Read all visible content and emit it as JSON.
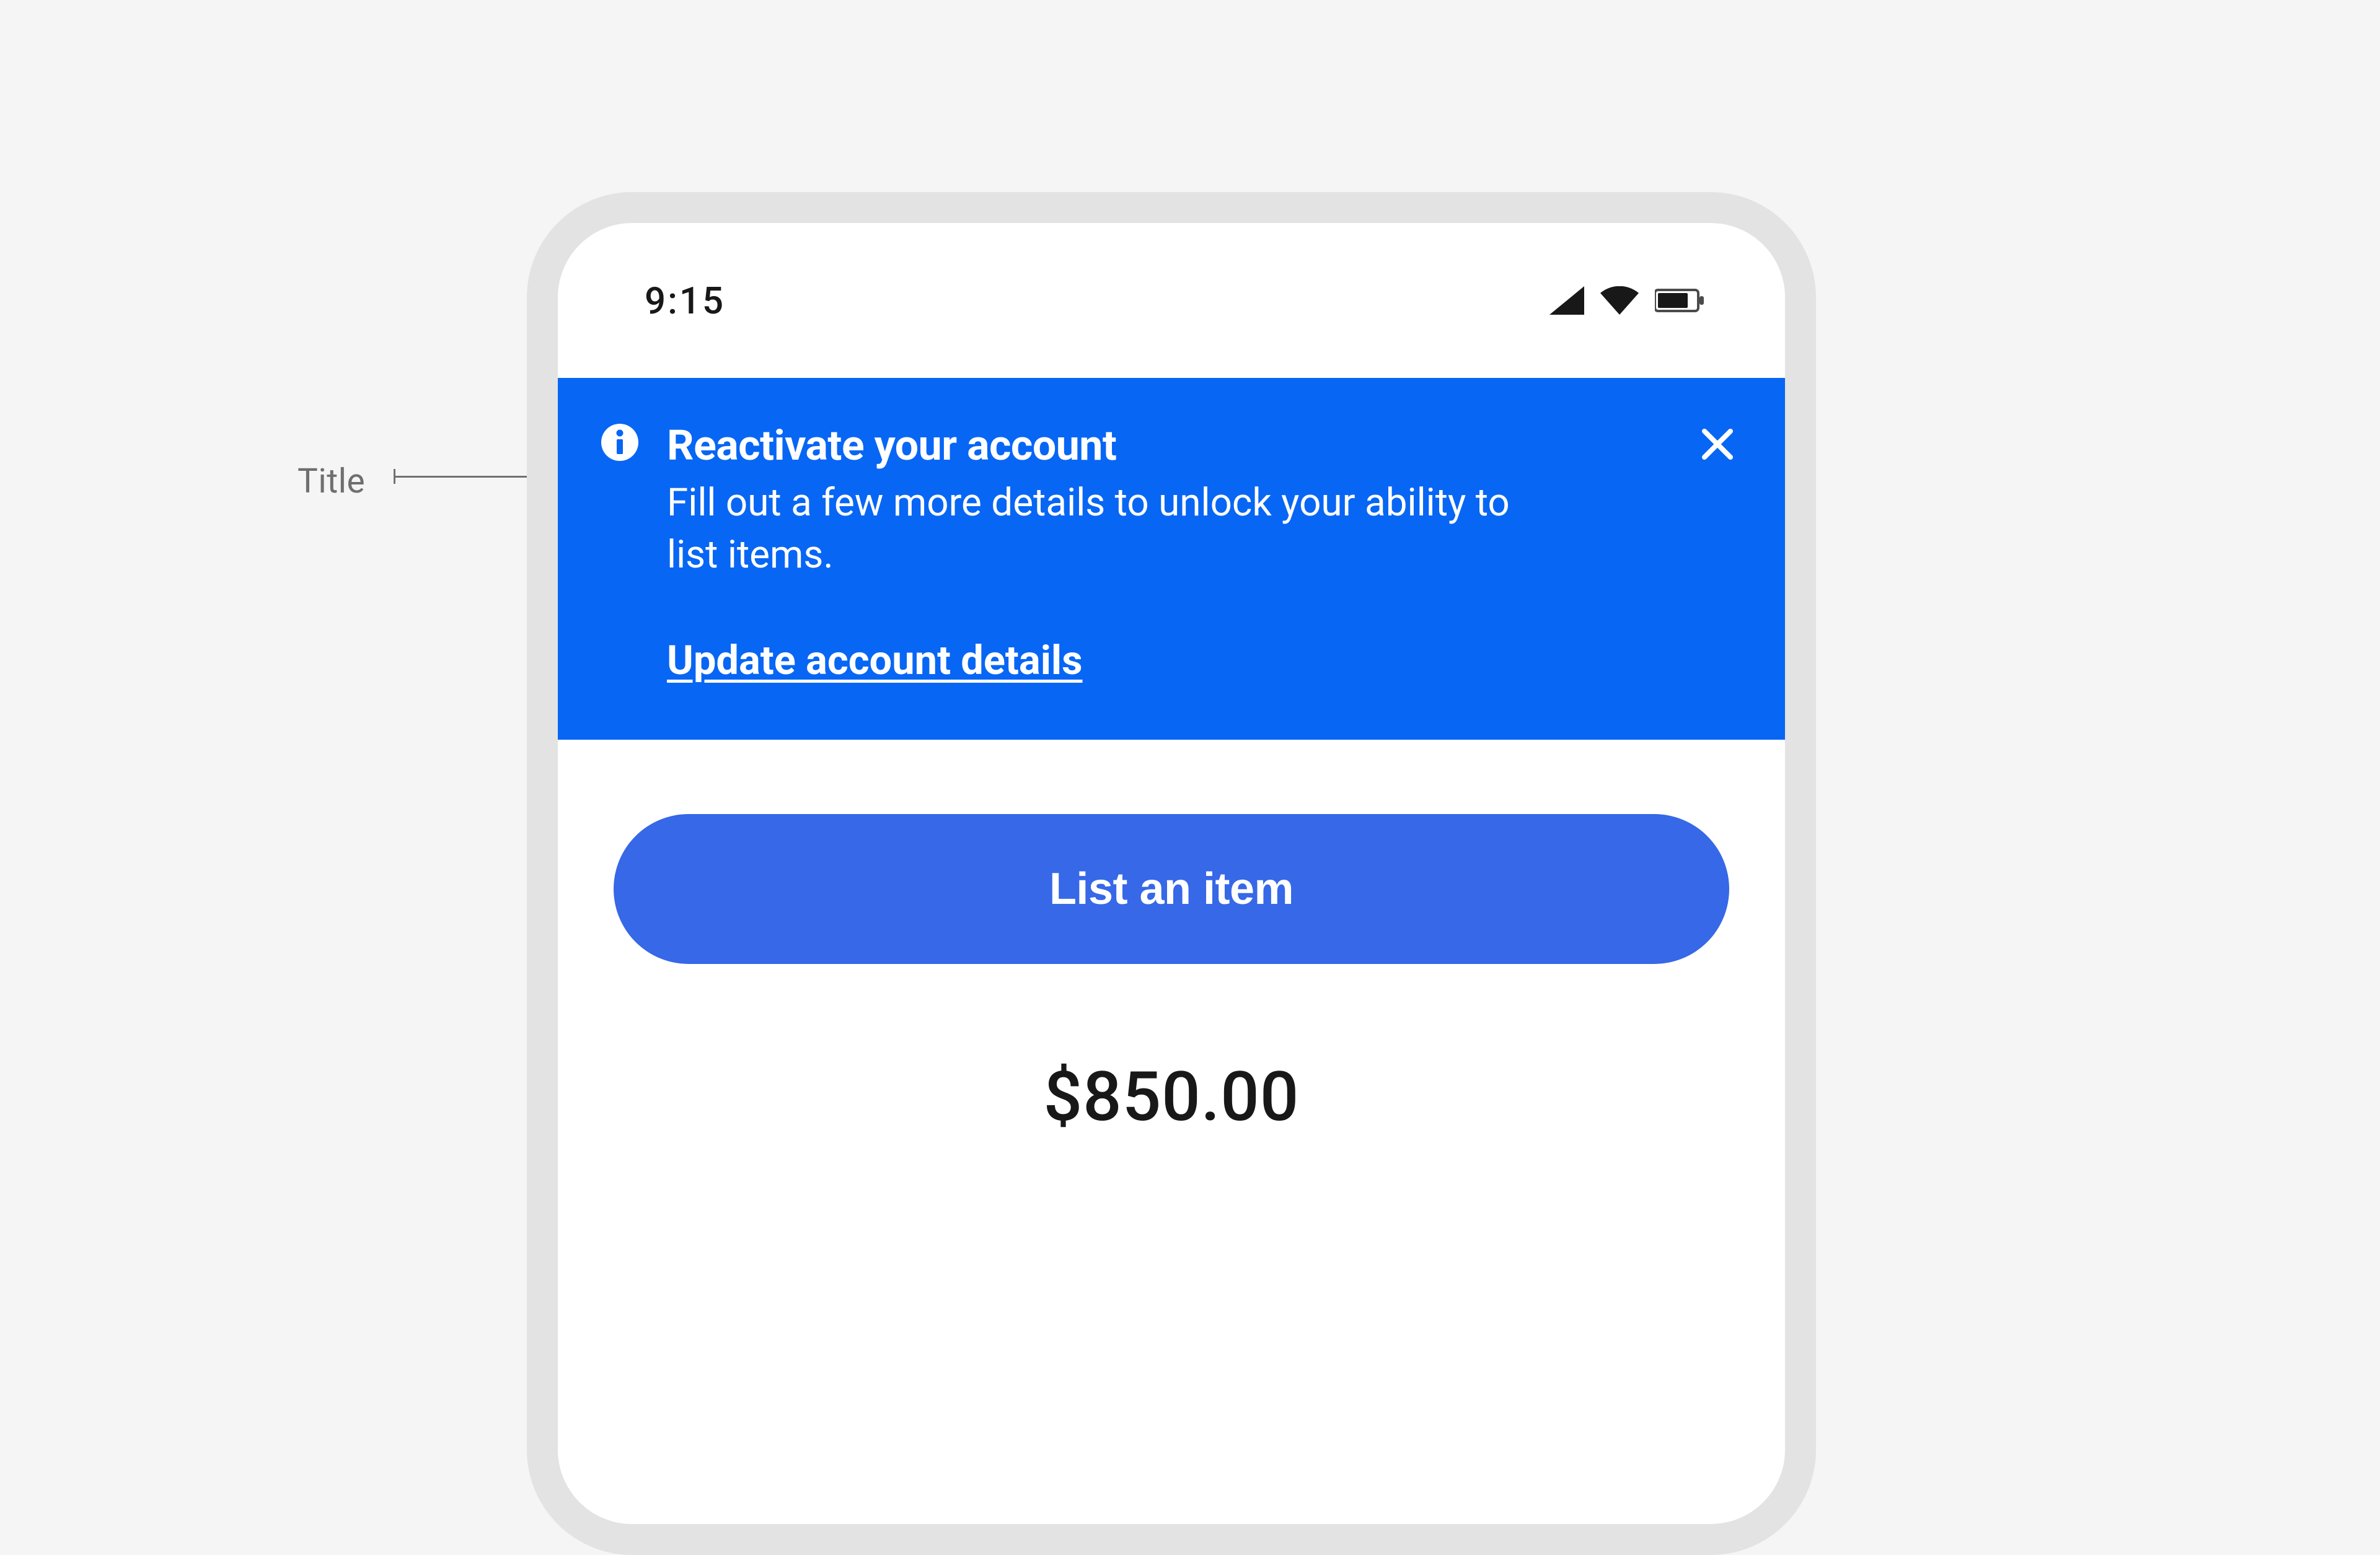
{
  "annotation": {
    "title_label": "Title"
  },
  "status": {
    "time": "9:15"
  },
  "banner": {
    "title": "Reactivate your account",
    "description": "Fill out a few more details to unlock your ability to list items.",
    "cta": "Update account details"
  },
  "main": {
    "button_label": "List an item",
    "amount": "$850.00"
  },
  "colors": {
    "banner": "#0866f4",
    "button": "#3668e7"
  }
}
